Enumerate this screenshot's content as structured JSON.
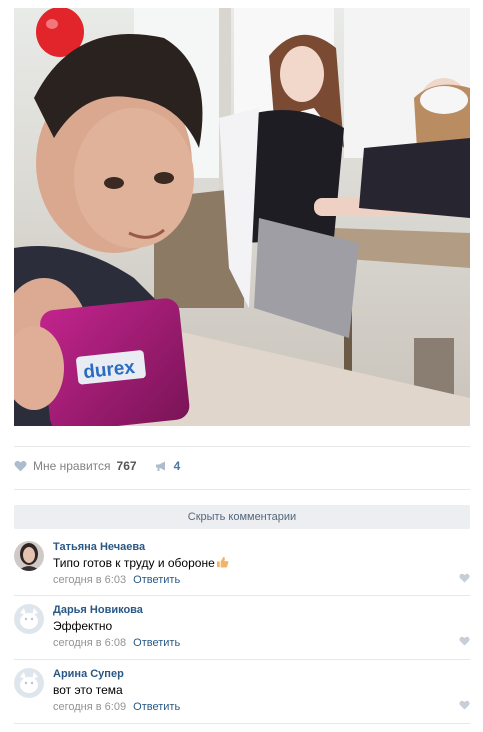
{
  "photo": {
    "brand_text": "durex"
  },
  "actions": {
    "like_label": "Мне нравится",
    "like_count": "767",
    "share_count": "4"
  },
  "hide_comments_label": "Скрыть комментарии",
  "comments": [
    {
      "author": "Татьяна Нечаева",
      "text": "Типо готов к труду и обороне",
      "emoji": "thumbs-up",
      "time": "сегодня в 6:03",
      "reply": "Ответить"
    },
    {
      "author": "Дарья Новикова",
      "text": "Эффектно",
      "time": "сегодня в 6:08",
      "reply": "Ответить"
    },
    {
      "author": "Арина Супер",
      "text": "вот это тема",
      "time": "сегодня в 6:09",
      "reply": "Ответить"
    }
  ],
  "colors": {
    "link": "#2a5885",
    "muted": "#939393",
    "accent": "#4a76a8"
  }
}
